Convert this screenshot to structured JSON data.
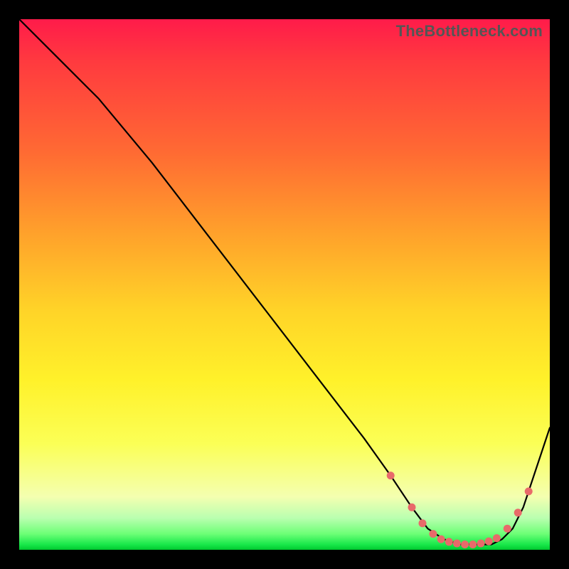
{
  "watermark": "TheBottleneck.com",
  "colors": {
    "frame": "#000000",
    "watermark": "#555555",
    "line": "#000000",
    "dot": "#e86a6a"
  },
  "chart_data": {
    "type": "line",
    "title": "",
    "xlabel": "",
    "ylabel": "",
    "xlim": [
      0,
      100
    ],
    "ylim": [
      0,
      100
    ],
    "grid": false,
    "legend": false,
    "series": [
      {
        "name": "bottleneck-curve",
        "x": [
          0,
          7,
          15,
          25,
          35,
          45,
          55,
          65,
          70,
          74,
          77,
          80,
          83,
          86,
          89,
          91,
          93,
          95,
          97,
          100
        ],
        "y": [
          100,
          93,
          85,
          73,
          60,
          47,
          34,
          21,
          14,
          8,
          4,
          2,
          1,
          1,
          1,
          2,
          4,
          8,
          14,
          23
        ]
      }
    ],
    "markers": {
      "name": "valley-dots",
      "x": [
        70,
        74,
        76,
        78,
        79.5,
        81,
        82.5,
        84,
        85.5,
        87,
        88.5,
        90,
        92,
        94,
        96
      ],
      "y": [
        14,
        8,
        5,
        3,
        2,
        1.5,
        1.2,
        1.0,
        1.0,
        1.2,
        1.6,
        2.2,
        4,
        7,
        11
      ]
    }
  }
}
